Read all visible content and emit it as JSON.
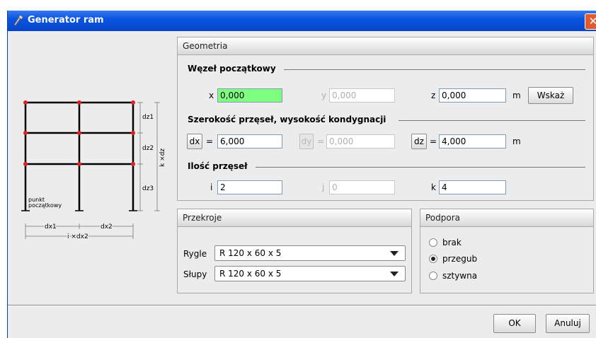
{
  "window": {
    "title": "Generator ram",
    "close_glyph": "✕"
  },
  "sketch": {
    "storey_labels": [
      "dz3",
      "dz2",
      "dz1"
    ],
    "height_total": "k ×dz",
    "origin_label_line1": "punkt",
    "origin_label_line2": "początkowy",
    "bay_labels": [
      "dx1",
      "dx2"
    ],
    "width_total": "i ×dx2"
  },
  "geometry": {
    "header": "Geometria",
    "start_node": {
      "heading": "Węzeł początkowy",
      "x_label": "x",
      "x_value": "0,000",
      "y_label": "y",
      "y_value": "0,000",
      "z_label": "z",
      "z_value": "0,000",
      "unit": "m",
      "pick_button": "Wskaż"
    },
    "spans": {
      "heading": "Szerokość przęseł, wysokość kondygnacji",
      "dx_button": "dx",
      "dx_eq": "=",
      "dx_value": "6,000",
      "dy_button": "dy",
      "dy_eq": "=",
      "dy_value": "0,000",
      "dz_button": "dz",
      "dz_eq": "=",
      "dz_value": "4,000",
      "unit": "m"
    },
    "counts": {
      "heading": "Ilość przęseł",
      "i_label": "i",
      "i_value": "2",
      "j_label": "j",
      "j_value": "0",
      "k_label": "k",
      "k_value": "4"
    }
  },
  "sections": {
    "header": "Przekroje",
    "beams_label": "Rygle",
    "beams_value": "R 120 x 60 x 5",
    "columns_label": "Słupy",
    "columns_value": "R 120 x 60 x 5"
  },
  "support": {
    "header": "Podpora",
    "options": [
      "brak",
      "przegub",
      "sztywna"
    ],
    "selected": "przegub"
  },
  "footer": {
    "ok": "OK",
    "cancel": "Anuluj"
  },
  "colors": {
    "titlebar": "#0a54e0",
    "active_field": "#7fff7f",
    "node": "#e02020"
  }
}
